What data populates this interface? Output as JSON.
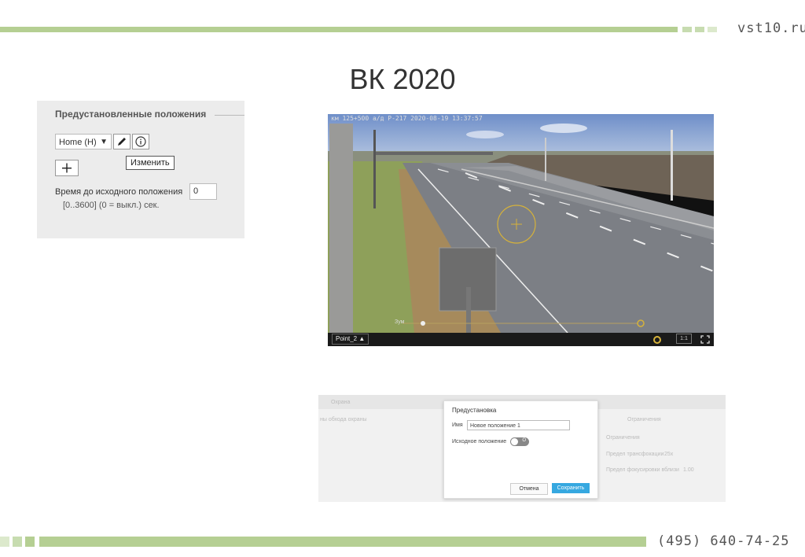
{
  "header": {
    "site": "vst10.ru",
    "title": "ВК 2020",
    "phone": "(495) 640-74-25"
  },
  "presets_panel": {
    "heading": "Предустановленные положения",
    "select_value": "Home (H)",
    "tooltip": "Изменить",
    "return_time_label": "Время до исходного положения",
    "return_time_value": "0",
    "range_hint": "[0..3600] (0 = выкл.) сек.",
    "icons": [
      "chevron-down-icon",
      "pencil-icon",
      "info-icon",
      "plus-icon"
    ]
  },
  "camera": {
    "osd": "км 125+500 а/д Р-217 2020-08-19 13:37:57",
    "preset_label": "Point_2",
    "zoom_label": "Зум",
    "ratio": "1:1"
  },
  "dialog": {
    "background_tab": "Охрана",
    "bg_labels": [
      "ны обхода охраны",
      "Ограничения",
      "Ограничения",
      "Предел трансфокации",
      "Предел фокусировки вблизи"
    ],
    "bg_values": [
      "25x",
      "1.00"
    ],
    "title": "Предустановка",
    "name_label": "Имя",
    "name_value": "Новое положение 1",
    "home_label": "Исходное положение",
    "toggle_text": "О",
    "cancel": "Отмена",
    "save": "Сохранить"
  },
  "colors": {
    "accent_green": "#b5cf93",
    "save_blue": "#36a8e0"
  }
}
